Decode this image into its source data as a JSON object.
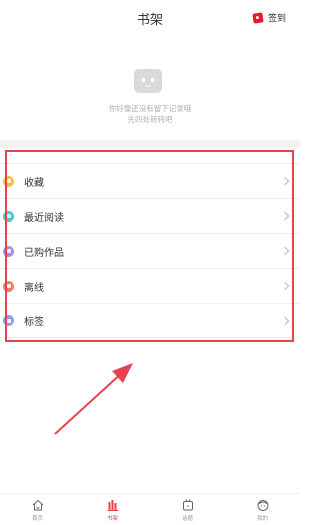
{
  "header": {
    "title": "书架",
    "signin_label": "签到",
    "signin_icon": "calendar-icon"
  },
  "empty_state": {
    "icon": "empty-face-icon",
    "line1": "你好像还没有留下记录哦",
    "line2": "先四处转转吧"
  },
  "menu": {
    "items": [
      {
        "label": "收藏",
        "icon": "star-icon",
        "color": "#f7c23a"
      },
      {
        "label": "最近阅读",
        "icon": "clock-icon",
        "color": "#4cc8c8"
      },
      {
        "label": "已购作品",
        "icon": "bag-icon",
        "color": "#a98be0"
      },
      {
        "label": "离线",
        "icon": "download-icon",
        "color": "#f47d6a"
      },
      {
        "label": "标签",
        "icon": "tag-icon",
        "color": "#8a9ff0"
      }
    ]
  },
  "annotation": {
    "highlight_color": "#e8424e"
  },
  "bottom_nav": {
    "items": [
      {
        "label": "首页",
        "icon": "home-icon",
        "active": false
      },
      {
        "label": "书架",
        "icon": "bookshelf-icon",
        "active": true
      },
      {
        "label": "话题",
        "icon": "topic-icon",
        "active": false
      },
      {
        "label": "我的",
        "icon": "profile-icon",
        "active": false
      }
    ]
  },
  "colors": {
    "accent": "#e8424e",
    "text": "#333333",
    "muted": "#b0b0b0"
  }
}
